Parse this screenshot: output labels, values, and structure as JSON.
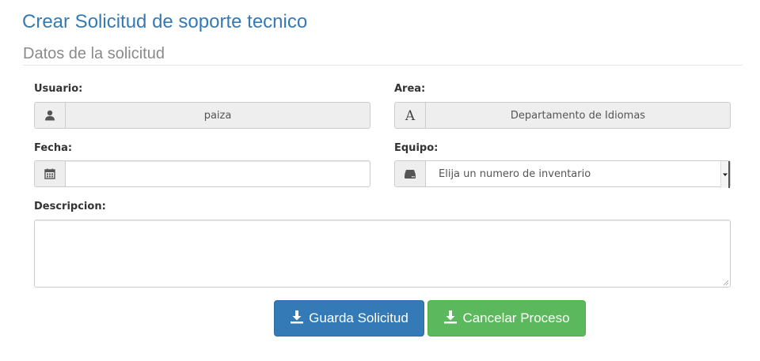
{
  "page": {
    "title": "Crear Solicitud de soporte tecnico",
    "section_title": "Datos de la solicitud"
  },
  "form": {
    "usuario": {
      "label": "Usuario:",
      "value": "paiza",
      "icon": "user-icon"
    },
    "area": {
      "label": "Area:",
      "value": "Departamento de Idiomas",
      "icon": "font-icon"
    },
    "fecha": {
      "label": "Fecha:",
      "value": "",
      "icon": "calendar-icon"
    },
    "equipo": {
      "label": "Equipo:",
      "selected": "Elija un numero de inventario",
      "icon": "hdd-icon"
    },
    "descripcion": {
      "label": "Descripcion:",
      "value": ""
    }
  },
  "buttons": {
    "save": {
      "label": "Guarda Solicitud",
      "icon": "download-icon",
      "color": "#337ab7"
    },
    "cancel": {
      "label": "Cancelar Proceso",
      "icon": "download-icon",
      "color": "#5cb85c"
    }
  },
  "colors": {
    "title": "#337ab7",
    "section": "#8a8a8a",
    "addon_bg": "#eeeeee"
  }
}
